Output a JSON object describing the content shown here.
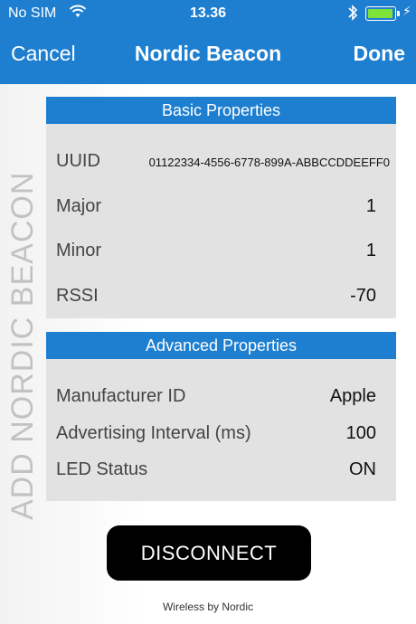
{
  "status_bar": {
    "carrier": "No SIM",
    "time": "13.36",
    "wifi_icon": "wifi-icon",
    "bluetooth_icon": "bluetooth-icon",
    "battery_icon": "battery-icon",
    "battery_level": 1.0,
    "charging_icon": "charging-bolt-icon"
  },
  "nav": {
    "cancel_label": "Cancel",
    "title": "Nordic Beacon",
    "done_label": "Done"
  },
  "side_label": "ADD NORDIC BEACON",
  "basic": {
    "header": "Basic Properties",
    "rows": [
      {
        "key": "UUID",
        "value": "01122334-4556-6778-899A-ABBCCDDEEFF0"
      },
      {
        "key": "Major",
        "value": "1"
      },
      {
        "key": "Minor",
        "value": "1"
      },
      {
        "key": "RSSI",
        "value": "-70"
      }
    ]
  },
  "advanced": {
    "header": "Advanced Properties",
    "rows": [
      {
        "key": "Manufacturer ID",
        "value": "Apple"
      },
      {
        "key": "Advertising Interval (ms)",
        "value": "100"
      },
      {
        "key": "LED Status",
        "value": "ON"
      }
    ]
  },
  "disconnect_label": "DISCONNECT",
  "footer": "Wireless by Nordic",
  "colors": {
    "accent": "#1e7fd0",
    "panel": "#e2e2e2",
    "battery_fill": "#7ee23a"
  }
}
